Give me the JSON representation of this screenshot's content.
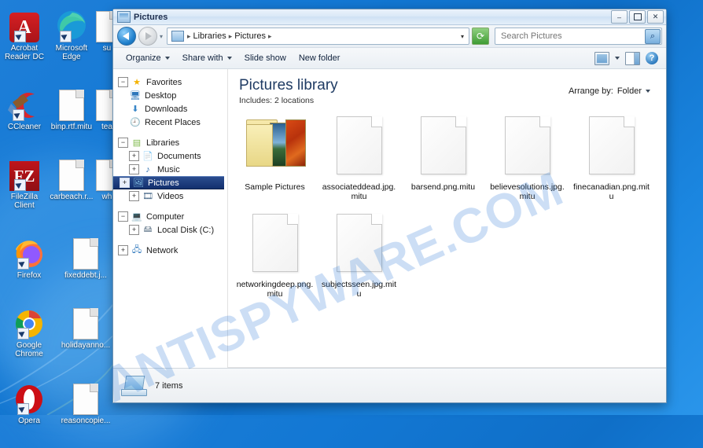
{
  "desktop": {
    "watermark": "ANTISPYWARE.COM",
    "icons": [
      {
        "label": "Acrobat Reader DC",
        "icon": "acrobat-icon",
        "shortcut": true
      },
      {
        "label": "Microsoft Edge",
        "icon": "edge-icon",
        "shortcut": true
      },
      {
        "label": "su",
        "icon": "document-icon",
        "shortcut": false
      },
      {
        "label": "CCleaner",
        "icon": "ccleaner-icon",
        "shortcut": true
      },
      {
        "label": "binp.rtf.mitu",
        "icon": "document-icon",
        "shortcut": false
      },
      {
        "label": "tea",
        "icon": "document-icon",
        "shortcut": false
      },
      {
        "label": "FileZilla Client",
        "icon": "filezilla-icon",
        "shortcut": true
      },
      {
        "label": "carbeach.r...",
        "icon": "document-icon",
        "shortcut": false
      },
      {
        "label": "wh",
        "icon": "document-icon",
        "shortcut": false
      },
      {
        "label": "Firefox",
        "icon": "firefox-icon",
        "shortcut": true
      },
      {
        "label": "fixeddebt.j...",
        "icon": "document-icon",
        "shortcut": false
      },
      {
        "label": "",
        "icon": "document-icon",
        "shortcut": false
      },
      {
        "label": "Google Chrome",
        "icon": "chrome-icon",
        "shortcut": true
      },
      {
        "label": "holidayanno...",
        "icon": "document-icon",
        "shortcut": false
      },
      {
        "label": "",
        "icon": "document-icon",
        "shortcut": false
      },
      {
        "label": "Opera",
        "icon": "opera-icon",
        "shortcut": true
      },
      {
        "label": "reasoncopie...",
        "icon": "document-icon",
        "shortcut": false
      },
      {
        "label": "",
        "icon": "document-icon",
        "shortcut": false
      }
    ]
  },
  "window": {
    "title": "Pictures",
    "title_icon": "folder-window-icon",
    "buttons": {
      "minimize": "–",
      "maximize": "❐",
      "close": "✕"
    },
    "nav": {
      "back_icon": "back-arrow-icon",
      "forward_icon": "forward-arrow-icon",
      "recent_icon": "recent-pages-icon",
      "breadcrumb_icon": "library-icon",
      "breadcrumbs": [
        "Libraries",
        "Pictures"
      ],
      "dropdown_icon": "chevron-down-icon",
      "refresh_icon": "refresh-icon"
    },
    "search": {
      "placeholder": "Search Pictures",
      "value": "",
      "icon": "search-icon"
    },
    "toolbar": {
      "organize": "Organize",
      "share_with": "Share with",
      "slide_show": "Slide show",
      "new_folder": "New folder",
      "view_icon": "change-view-icon",
      "view_caret_icon": "chevron-down-icon",
      "preview_icon": "preview-pane-icon",
      "help_icon": "help-icon"
    }
  },
  "navpane": {
    "nodes": [
      {
        "label": "Favorites",
        "icon": "star-icon",
        "toggle": "minus",
        "indent": 0
      },
      {
        "label": "Desktop",
        "icon": "desktop-icon",
        "toggle": "none",
        "indent": 1
      },
      {
        "label": "Downloads",
        "icon": "downloads-icon",
        "toggle": "none",
        "indent": 1
      },
      {
        "label": "Recent Places",
        "icon": "recent-places-icon",
        "toggle": "none",
        "indent": 1
      },
      {
        "label": "Libraries",
        "icon": "libraries-icon",
        "toggle": "minus",
        "indent": 0
      },
      {
        "label": "Documents",
        "icon": "documents-icon",
        "toggle": "plus",
        "indent": 1
      },
      {
        "label": "Music",
        "icon": "music-icon",
        "toggle": "plus",
        "indent": 1
      },
      {
        "label": "Pictures",
        "icon": "pictures-icon",
        "toggle": "plus",
        "indent": 1,
        "selected": true
      },
      {
        "label": "Videos",
        "icon": "videos-icon",
        "toggle": "plus",
        "indent": 1
      },
      {
        "label": "Computer",
        "icon": "computer-icon",
        "toggle": "minus",
        "indent": 0
      },
      {
        "label": "Local Disk (C:)",
        "icon": "disk-icon",
        "toggle": "plus",
        "indent": 1
      },
      {
        "label": "Network",
        "icon": "network-icon",
        "toggle": "plus",
        "indent": 0
      }
    ]
  },
  "library": {
    "title": "Pictures library",
    "subtitle": "Includes:  2 locations",
    "arrange_label": "Arrange by:",
    "arrange_value": "Folder",
    "arrange_caret_icon": "chevron-down-icon"
  },
  "files": [
    {
      "name": "Sample Pictures",
      "type": "folder"
    },
    {
      "name": "associateddead.jpg.mitu",
      "type": "file"
    },
    {
      "name": "barsend.png.mitu",
      "type": "file"
    },
    {
      "name": "believesolutions.jpg.mitu",
      "type": "file"
    },
    {
      "name": "finecanadian.png.mitu",
      "type": "file"
    },
    {
      "name": "networkingdeep.png.mitu",
      "type": "file"
    },
    {
      "name": "subjectsseen.jpg.mitu",
      "type": "file"
    }
  ],
  "statusbar": {
    "icon": "computer-status-icon",
    "text": "7 items"
  }
}
